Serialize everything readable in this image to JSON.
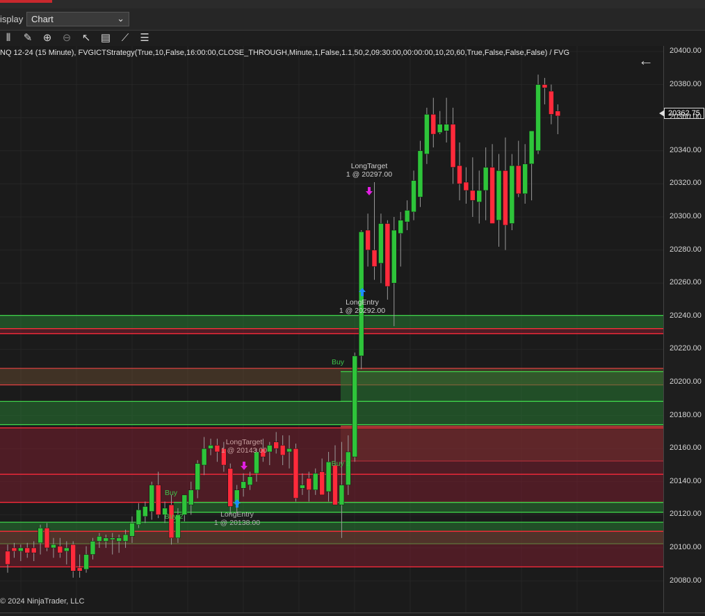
{
  "display_bar": {
    "label": "isplay",
    "selected": "Chart"
  },
  "toolbar": {
    "tools": [
      {
        "name": "bar-chart-icon",
        "glyph": "⫴"
      },
      {
        "name": "pencil-icon",
        "glyph": "✎"
      },
      {
        "name": "zoom-in-icon",
        "glyph": "⊕"
      },
      {
        "name": "zoom-out-icon",
        "glyph": "⊖"
      },
      {
        "name": "pointer-icon",
        "glyph": "↖"
      },
      {
        "name": "properties-icon",
        "glyph": "▤"
      },
      {
        "name": "strategy-icon",
        "glyph": "⟋"
      },
      {
        "name": "list-icon",
        "glyph": "☰"
      }
    ]
  },
  "chart": {
    "title": "NQ 12-24 (15 Minute), FVGICTStrategy(True,10,False,16:00:00,CLOSE_THROUGH,Minute,1,False,1.1,50,2,09:30:00,00:00:00,10,20,60,True,False,False,False) / FVG",
    "copyright": "© 2024 NinjaTrader, LLC",
    "current_price": "20362.75",
    "y_ticks": [
      "20400.00",
      "20380.00",
      "20360.00",
      "20340.00",
      "20320.00",
      "20300.00",
      "20280.00",
      "20260.00",
      "20240.00",
      "20220.00",
      "20200.00",
      "20180.00",
      "20160.00",
      "20140.00",
      "20120.00",
      "20100.00",
      "20080.00"
    ],
    "colors": {
      "up": "#2ec43a",
      "down": "#ff2a3b",
      "bg": "#1b1b1b",
      "zone_green": "#1f5c28",
      "zone_red": "#5a1f26",
      "marker_magenta": "#e020e0",
      "marker_blue": "#1e8cff"
    }
  },
  "chart_data": {
    "type": "candlestick",
    "ylim": [
      20073,
      20405
    ],
    "y_ticks": [
      20080,
      20100,
      20120,
      20140,
      20160,
      20180,
      20200,
      20220,
      20240,
      20260,
      20280,
      20300,
      20320,
      20340,
      20360,
      20380,
      20400
    ],
    "candles": [
      {
        "o": 20098,
        "h": 20102,
        "l": 20085,
        "c": 20090
      },
      {
        "o": 20100,
        "h": 20103,
        "l": 20094,
        "c": 20098
      },
      {
        "o": 20098,
        "h": 20102,
        "l": 20092,
        "c": 20100
      },
      {
        "o": 20100,
        "h": 20103,
        "l": 20094,
        "c": 20097
      },
      {
        "o": 20100,
        "h": 20104,
        "l": 20092,
        "c": 20097
      },
      {
        "o": 20103,
        "h": 20114,
        "l": 20096,
        "c": 20112
      },
      {
        "o": 20112,
        "h": 20115,
        "l": 20098,
        "c": 20100
      },
      {
        "o": 20100,
        "h": 20106,
        "l": 20094,
        "c": 20102
      },
      {
        "o": 20101,
        "h": 20106,
        "l": 20094,
        "c": 20097
      },
      {
        "o": 20098,
        "h": 20104,
        "l": 20090,
        "c": 20100
      },
      {
        "o": 20102,
        "h": 20104,
        "l": 20082,
        "c": 20086
      },
      {
        "o": 20088,
        "h": 20096,
        "l": 20082,
        "c": 20086
      },
      {
        "o": 20087,
        "h": 20101,
        "l": 20085,
        "c": 20096
      },
      {
        "o": 20096,
        "h": 20106,
        "l": 20093,
        "c": 20104
      },
      {
        "o": 20104,
        "h": 20109,
        "l": 20100,
        "c": 20107
      },
      {
        "o": 20104,
        "h": 20108,
        "l": 20100,
        "c": 20106
      },
      {
        "o": 20105,
        "h": 20109,
        "l": 20096,
        "c": 20106
      },
      {
        "o": 20104,
        "h": 20108,
        "l": 20097,
        "c": 20106
      },
      {
        "o": 20104,
        "h": 20111,
        "l": 20100,
        "c": 20108
      },
      {
        "o": 20107,
        "h": 20119,
        "l": 20103,
        "c": 20115
      },
      {
        "o": 20114,
        "h": 20127,
        "l": 20112,
        "c": 20123
      },
      {
        "o": 20119,
        "h": 20128,
        "l": 20115,
        "c": 20125
      },
      {
        "o": 20122,
        "h": 20140,
        "l": 20117,
        "c": 20138
      },
      {
        "o": 20138,
        "h": 20146,
        "l": 20118,
        "c": 20120
      },
      {
        "o": 20120,
        "h": 20128,
        "l": 20115,
        "c": 20124
      },
      {
        "o": 20126,
        "h": 20132,
        "l": 20102,
        "c": 20106
      },
      {
        "o": 20106,
        "h": 20124,
        "l": 20103,
        "c": 20120
      },
      {
        "o": 20120,
        "h": 20131,
        "l": 20116,
        "c": 20132
      },
      {
        "o": 20126,
        "h": 20140,
        "l": 20120,
        "c": 20135
      },
      {
        "o": 20135,
        "h": 20153,
        "l": 20130,
        "c": 20151
      },
      {
        "o": 20150,
        "h": 20167,
        "l": 20144,
        "c": 20160
      },
      {
        "o": 20160,
        "h": 20166,
        "l": 20156,
        "c": 20162
      },
      {
        "o": 20162,
        "h": 20166,
        "l": 20152,
        "c": 20158
      },
      {
        "o": 20160,
        "h": 20164,
        "l": 20146,
        "c": 20150
      },
      {
        "o": 20148,
        "h": 20151,
        "l": 20120,
        "c": 20125
      },
      {
        "o": 20126,
        "h": 20138,
        "l": 20121,
        "c": 20135
      },
      {
        "o": 20136,
        "h": 20145,
        "l": 20131,
        "c": 20140
      },
      {
        "o": 20138,
        "h": 20146,
        "l": 20135,
        "c": 20143
      },
      {
        "o": 20145,
        "h": 20160,
        "l": 20140,
        "c": 20158
      },
      {
        "o": 20160,
        "h": 20166,
        "l": 20152,
        "c": 20155
      },
      {
        "o": 20158,
        "h": 20164,
        "l": 20150,
        "c": 20162
      },
      {
        "o": 20164,
        "h": 20170,
        "l": 20157,
        "c": 20160
      },
      {
        "o": 20162,
        "h": 20168,
        "l": 20150,
        "c": 20156
      },
      {
        "o": 20158,
        "h": 20168,
        "l": 20148,
        "c": 20160
      },
      {
        "o": 20160,
        "h": 20163,
        "l": 20128,
        "c": 20130
      },
      {
        "o": 20136,
        "h": 20145,
        "l": 20132,
        "c": 20138
      },
      {
        "o": 20142,
        "h": 20146,
        "l": 20128,
        "c": 20135
      },
      {
        "o": 20135,
        "h": 20148,
        "l": 20132,
        "c": 20145
      },
      {
        "o": 20146,
        "h": 20154,
        "l": 20137,
        "c": 20132
      },
      {
        "o": 20134,
        "h": 20158,
        "l": 20128,
        "c": 20152
      },
      {
        "o": 20150,
        "h": 20162,
        "l": 20128,
        "c": 20126
      },
      {
        "o": 20126,
        "h": 20164,
        "l": 20106,
        "c": 20138
      },
      {
        "o": 20138,
        "h": 20168,
        "l": 20132,
        "c": 20158
      },
      {
        "o": 20155,
        "h": 20218,
        "l": 20152,
        "c": 20216
      },
      {
        "o": 20216,
        "h": 20292,
        "l": 20208,
        "c": 20291
      },
      {
        "o": 20292,
        "h": 20302,
        "l": 20270,
        "c": 20280
      },
      {
        "o": 20280,
        "h": 20321,
        "l": 20262,
        "c": 20270
      },
      {
        "o": 20272,
        "h": 20302,
        "l": 20260,
        "c": 20296
      },
      {
        "o": 20296,
        "h": 20298,
        "l": 20250,
        "c": 20258
      },
      {
        "o": 20260,
        "h": 20300,
        "l": 20234,
        "c": 20292
      },
      {
        "o": 20290,
        "h": 20303,
        "l": 20270,
        "c": 20298
      },
      {
        "o": 20297,
        "h": 20310,
        "l": 20292,
        "c": 20304
      },
      {
        "o": 20303,
        "h": 20328,
        "l": 20298,
        "c": 20322
      },
      {
        "o": 20312,
        "h": 20346,
        "l": 20306,
        "c": 20340
      },
      {
        "o": 20338,
        "h": 20366,
        "l": 20332,
        "c": 20362
      },
      {
        "o": 20362,
        "h": 20372,
        "l": 20342,
        "c": 20350
      },
      {
        "o": 20351,
        "h": 20364,
        "l": 20350,
        "c": 20356
      },
      {
        "o": 20352,
        "h": 20372,
        "l": 20345,
        "c": 20356
      },
      {
        "o": 20356,
        "h": 20366,
        "l": 20320,
        "c": 20330
      },
      {
        "o": 20331,
        "h": 20345,
        "l": 20310,
        "c": 20320
      },
      {
        "o": 20321,
        "h": 20330,
        "l": 20308,
        "c": 20316
      },
      {
        "o": 20316,
        "h": 20336,
        "l": 20300,
        "c": 20310
      },
      {
        "o": 20309,
        "h": 20328,
        "l": 20296,
        "c": 20316
      },
      {
        "o": 20316,
        "h": 20342,
        "l": 20298,
        "c": 20330
      },
      {
        "o": 20330,
        "h": 20344,
        "l": 20298,
        "c": 20296
      },
      {
        "o": 20298,
        "h": 20338,
        "l": 20282,
        "c": 20328
      },
      {
        "o": 20328,
        "h": 20348,
        "l": 20280,
        "c": 20295
      },
      {
        "o": 20296,
        "h": 20338,
        "l": 20292,
        "c": 20331
      },
      {
        "o": 20331,
        "h": 20346,
        "l": 20312,
        "c": 20314
      },
      {
        "o": 20314,
        "h": 20344,
        "l": 20308,
        "c": 20332
      },
      {
        "o": 20332,
        "h": 20352,
        "l": 20310,
        "c": 20352
      },
      {
        "o": 20340,
        "h": 20386,
        "l": 20338,
        "c": 20380
      },
      {
        "o": 20380,
        "h": 20384,
        "l": 20368,
        "c": 20378
      },
      {
        "o": 20376,
        "h": 20380,
        "l": 20356,
        "c": 20362
      },
      {
        "o": 20364,
        "h": 20368,
        "l": 20350,
        "c": 20361
      }
    ],
    "zones": [
      {
        "from": 20240.5,
        "to": 20232.5,
        "color": "green"
      },
      {
        "from": 20232.5,
        "to": 20229.5,
        "color": "red"
      },
      {
        "from": 20208.5,
        "to": 20198.5,
        "color": "brown"
      },
      {
        "from": 20206.5,
        "to": 20188.5,
        "color": "green"
      },
      {
        "from": 20188.5,
        "to": 20174.5,
        "color": "green"
      },
      {
        "from": 20173.5,
        "to": 20152.5,
        "color": "brown"
      },
      {
        "from": 20172.5,
        "to": 20144.5,
        "color": "red"
      },
      {
        "from": 20144.5,
        "to": 20127.5,
        "color": "red"
      },
      {
        "from": 20127.5,
        "to": 20121.5,
        "color": "green"
      },
      {
        "from": 20115.5,
        "to": 20102.5,
        "color": "green"
      },
      {
        "from": 20110,
        "to": 20088.5,
        "color": "red"
      }
    ],
    "annotations": [
      {
        "label": "LongTarget",
        "sub": "1 @ 20297.00"
      },
      {
        "label": "LongEntry",
        "sub": "1 @ 20292.00"
      },
      {
        "label": "LongTarget",
        "sub": "1 @ 20143.00"
      },
      {
        "label": "LongEntry",
        "sub": "1 @ 20138.00"
      },
      {
        "label": "Buy",
        "sub": ""
      },
      {
        "label": "Buy",
        "sub": ""
      },
      {
        "label": "Buy 2",
        "sub": ""
      },
      {
        "label": "Buy 2",
        "sub": ""
      }
    ]
  }
}
